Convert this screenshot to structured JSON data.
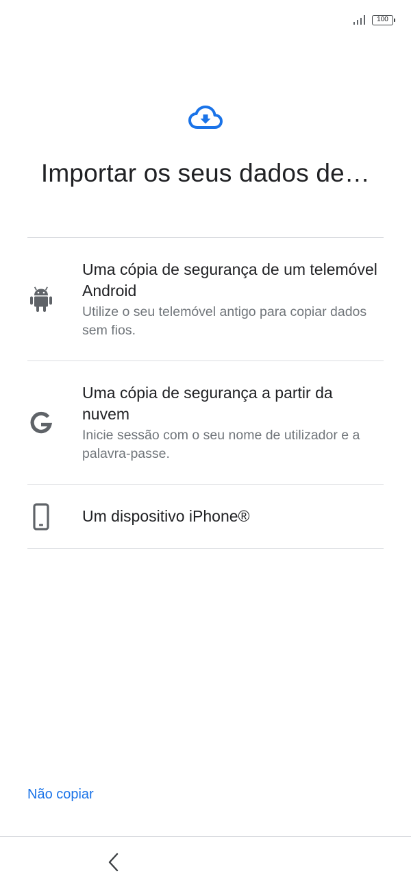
{
  "status_bar": {
    "battery_level": "100",
    "signal_icon": "signal-bars-icon",
    "battery_icon": "battery-icon"
  },
  "header": {
    "icon": "cloud-download-icon",
    "title": "Importar os seus dados de…"
  },
  "options": [
    {
      "icon": "android-icon",
      "title": "Uma cópia de segurança de um telemóvel Android",
      "description": "Utilize o seu telemóvel antigo para copiar dados sem fios."
    },
    {
      "icon": "google-g-icon",
      "title": "Uma cópia de segurança a partir da nuvem",
      "description": "Inicie sessão com o seu nome de utilizador e a palavra-passe."
    },
    {
      "icon": "smartphone-icon",
      "title": "Um dispositivo iPhone®",
      "description": ""
    }
  ],
  "footer": {
    "skip_label": "Não copiar"
  },
  "nav_bar": {
    "back_icon": "chevron-left-icon"
  },
  "colors": {
    "accent": "#1a73e8",
    "text_primary": "#202124",
    "text_secondary": "#70757a",
    "icon_gray": "#5f6368",
    "divider": "#dadce0"
  }
}
